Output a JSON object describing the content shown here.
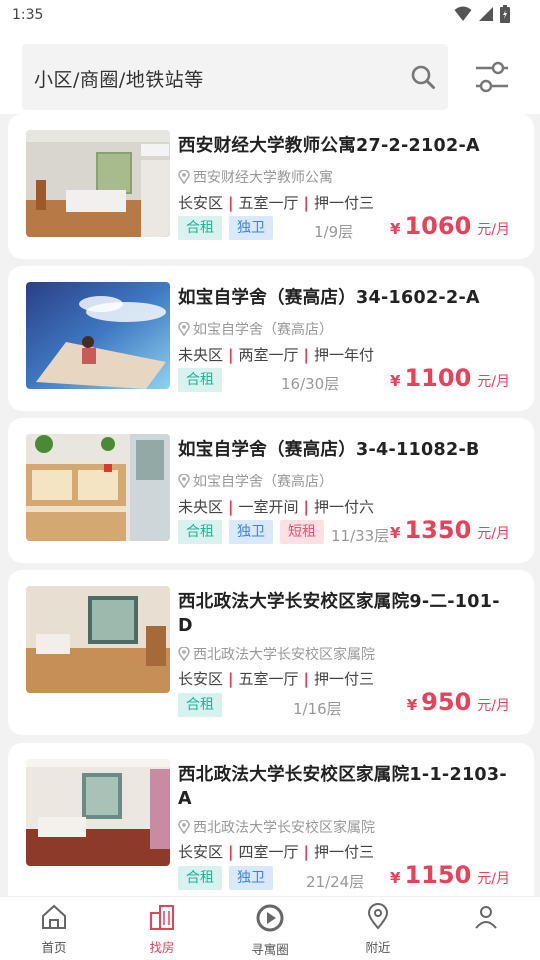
{
  "status": {
    "time": "1:35"
  },
  "search": {
    "placeholder": "小区/商圈/地铁站等"
  },
  "listings": [
    {
      "title": "西安财经大学教师公寓27-2-2102-A",
      "address": "西安财经大学教师公寓",
      "district": "长安区",
      "layout": "五室一厅",
      "payment": "押一付三",
      "tags": [
        {
          "text": "合租",
          "color": "green"
        },
        {
          "text": "独卫",
          "color": "blue"
        }
      ],
      "floor": "1/9层",
      "currency": "¥",
      "price": "1060",
      "unit": "元/月"
    },
    {
      "title": "如宝自学舍（赛高店）34-1602-2-A",
      "address": "如宝自学舍（赛高店）",
      "district": "未央区",
      "layout": "两室一厅",
      "payment": "押一年付",
      "tags": [
        {
          "text": "合租",
          "color": "green"
        }
      ],
      "floor": "16/30层",
      "currency": "¥",
      "price": "1100",
      "unit": "元/月"
    },
    {
      "title": "如宝自学舍（赛高店）3-4-11082-B",
      "address": "如宝自学舍（赛高店）",
      "district": "未央区",
      "layout": "一室开间",
      "payment": "押一付六",
      "tags": [
        {
          "text": "合租",
          "color": "green"
        },
        {
          "text": "独卫",
          "color": "blue"
        },
        {
          "text": "短租",
          "color": "pink"
        }
      ],
      "floor": "11/33层",
      "currency": "¥",
      "price": "1350",
      "unit": "元/月"
    },
    {
      "title": "西北政法大学长安校区家属院9-二-101-D",
      "address": "西北政法大学长安校区家属院",
      "district": "长安区",
      "layout": "五室一厅",
      "payment": "押一付三",
      "tags": [
        {
          "text": "合租",
          "color": "green"
        }
      ],
      "floor": "1/16层",
      "currency": "¥",
      "price": "950",
      "unit": "元/月"
    },
    {
      "title": "西北政法大学长安校区家属院1-1-2103-A",
      "address": "西北政法大学长安校区家属院",
      "district": "长安区",
      "layout": "四室一厅",
      "payment": "押一付三",
      "tags": [
        {
          "text": "合租",
          "color": "green"
        },
        {
          "text": "独卫",
          "color": "blue"
        }
      ],
      "floor": "21/24层",
      "currency": "¥",
      "price": "1150",
      "unit": "元/月"
    }
  ],
  "tabs": [
    {
      "label": "首页",
      "icon": "home-icon",
      "active": false
    },
    {
      "label": "找房",
      "icon": "buildings-icon",
      "active": true
    },
    {
      "label": "寻寓圈",
      "icon": "play-circle-icon",
      "active": false
    },
    {
      "label": "附近",
      "icon": "location-icon",
      "active": false
    },
    {
      "label": "",
      "icon": "profile-icon",
      "active": false
    }
  ],
  "colors": {
    "accent": "#e8415a",
    "tag_green": "#1fb59b",
    "tag_blue": "#3b84db",
    "tag_pink": "#ea5272"
  }
}
